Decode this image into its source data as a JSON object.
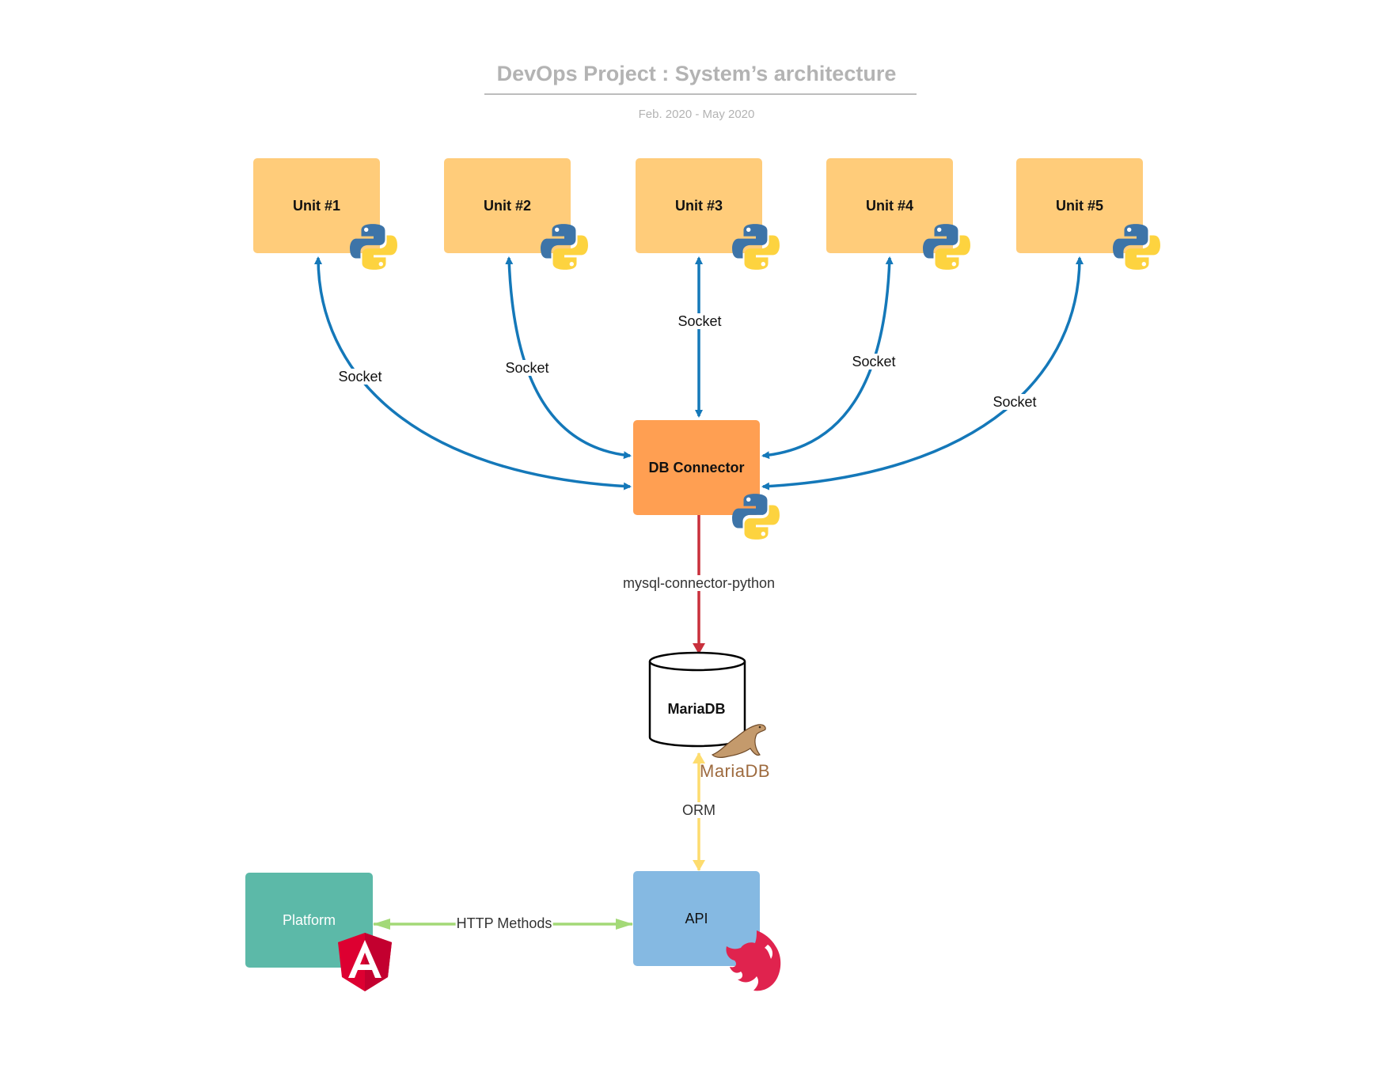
{
  "header": {
    "title": "DevOps Project : System’s architecture",
    "subtitle": "Feb. 2020 - May 2020"
  },
  "nodes": {
    "units": [
      {
        "label": "Unit #1",
        "icon": "python-logo-icon"
      },
      {
        "label": "Unit #2",
        "icon": "python-logo-icon"
      },
      {
        "label": "Unit #3",
        "icon": "python-logo-icon"
      },
      {
        "label": "Unit #4",
        "icon": "python-logo-icon"
      },
      {
        "label": "Unit #5",
        "icon": "python-logo-icon"
      }
    ],
    "db_connector": {
      "label": "DB Connector",
      "icon": "python-logo-icon"
    },
    "database": {
      "label": "MariaDB",
      "icon": "mariadb-seal-logo-icon",
      "logo_text": "MariaDB"
    },
    "api": {
      "label": "API",
      "icon": "nestjs-logo-icon"
    },
    "platform": {
      "label": "Platform",
      "icon": "angular-logo-icon"
    }
  },
  "edges": {
    "unit_sockets": [
      {
        "from": "Unit #1",
        "to": "DB Connector",
        "label": "Socket",
        "bidirectional": true
      },
      {
        "from": "Unit #2",
        "to": "DB Connector",
        "label": "Socket",
        "bidirectional": true
      },
      {
        "from": "Unit #3",
        "to": "DB Connector",
        "label": "Socket",
        "bidirectional": true
      },
      {
        "from": "Unit #4",
        "to": "DB Connector",
        "label": "Socket",
        "bidirectional": true
      },
      {
        "from": "Unit #5",
        "to": "DB Connector",
        "label": "Socket",
        "bidirectional": true
      }
    ],
    "connector_db": {
      "from": "DB Connector",
      "to": "MariaDB",
      "label": "mysql-connector-python",
      "bidirectional": false
    },
    "db_api": {
      "from": "MariaDB",
      "to": "API",
      "label": "ORM",
      "bidirectional": true
    },
    "platform_api": {
      "from": "Platform",
      "to": "API",
      "label": "HTTP Methods",
      "bidirectional": true
    }
  },
  "colors": {
    "unit_fill": "#ffcc7a",
    "connector_fill": "#ff9f52",
    "api_fill": "#85b9e2",
    "platform_fill": "#5cb9a8",
    "socket_edge": "#1478b9",
    "mysql_edge": "#c9303c",
    "orm_edge": "#fddc6e",
    "http_edge": "#a3d977",
    "title": "#b3b3b3"
  }
}
